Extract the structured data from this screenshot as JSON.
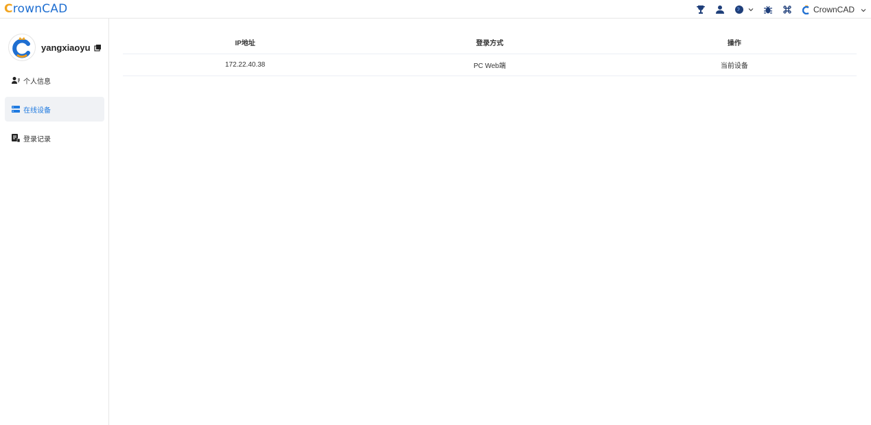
{
  "app": {
    "logo_text": "rownCAD",
    "logo_initial": "C"
  },
  "topbar": {
    "icons": [
      "trophy-icon",
      "user-icon",
      "globe-icon",
      "bug-icon",
      "command-icon"
    ],
    "account_label": "CrownCAD"
  },
  "sidebar": {
    "username": "yangxiaoyu",
    "items": [
      {
        "label": "个人信息",
        "icon": "user-card-icon",
        "active": false
      },
      {
        "label": "在线设备",
        "icon": "server-icon",
        "active": true
      },
      {
        "label": "登录记录",
        "icon": "log-icon",
        "active": false
      }
    ]
  },
  "table": {
    "headers": [
      "IP地址",
      "登录方式",
      "操作"
    ],
    "rows": [
      [
        "172.22.40.38",
        "PC Web端",
        "当前设备"
      ]
    ]
  },
  "colors": {
    "accent": "#1f7ae0",
    "brand": "#1f6fd1",
    "crown": "#f2a41f"
  }
}
